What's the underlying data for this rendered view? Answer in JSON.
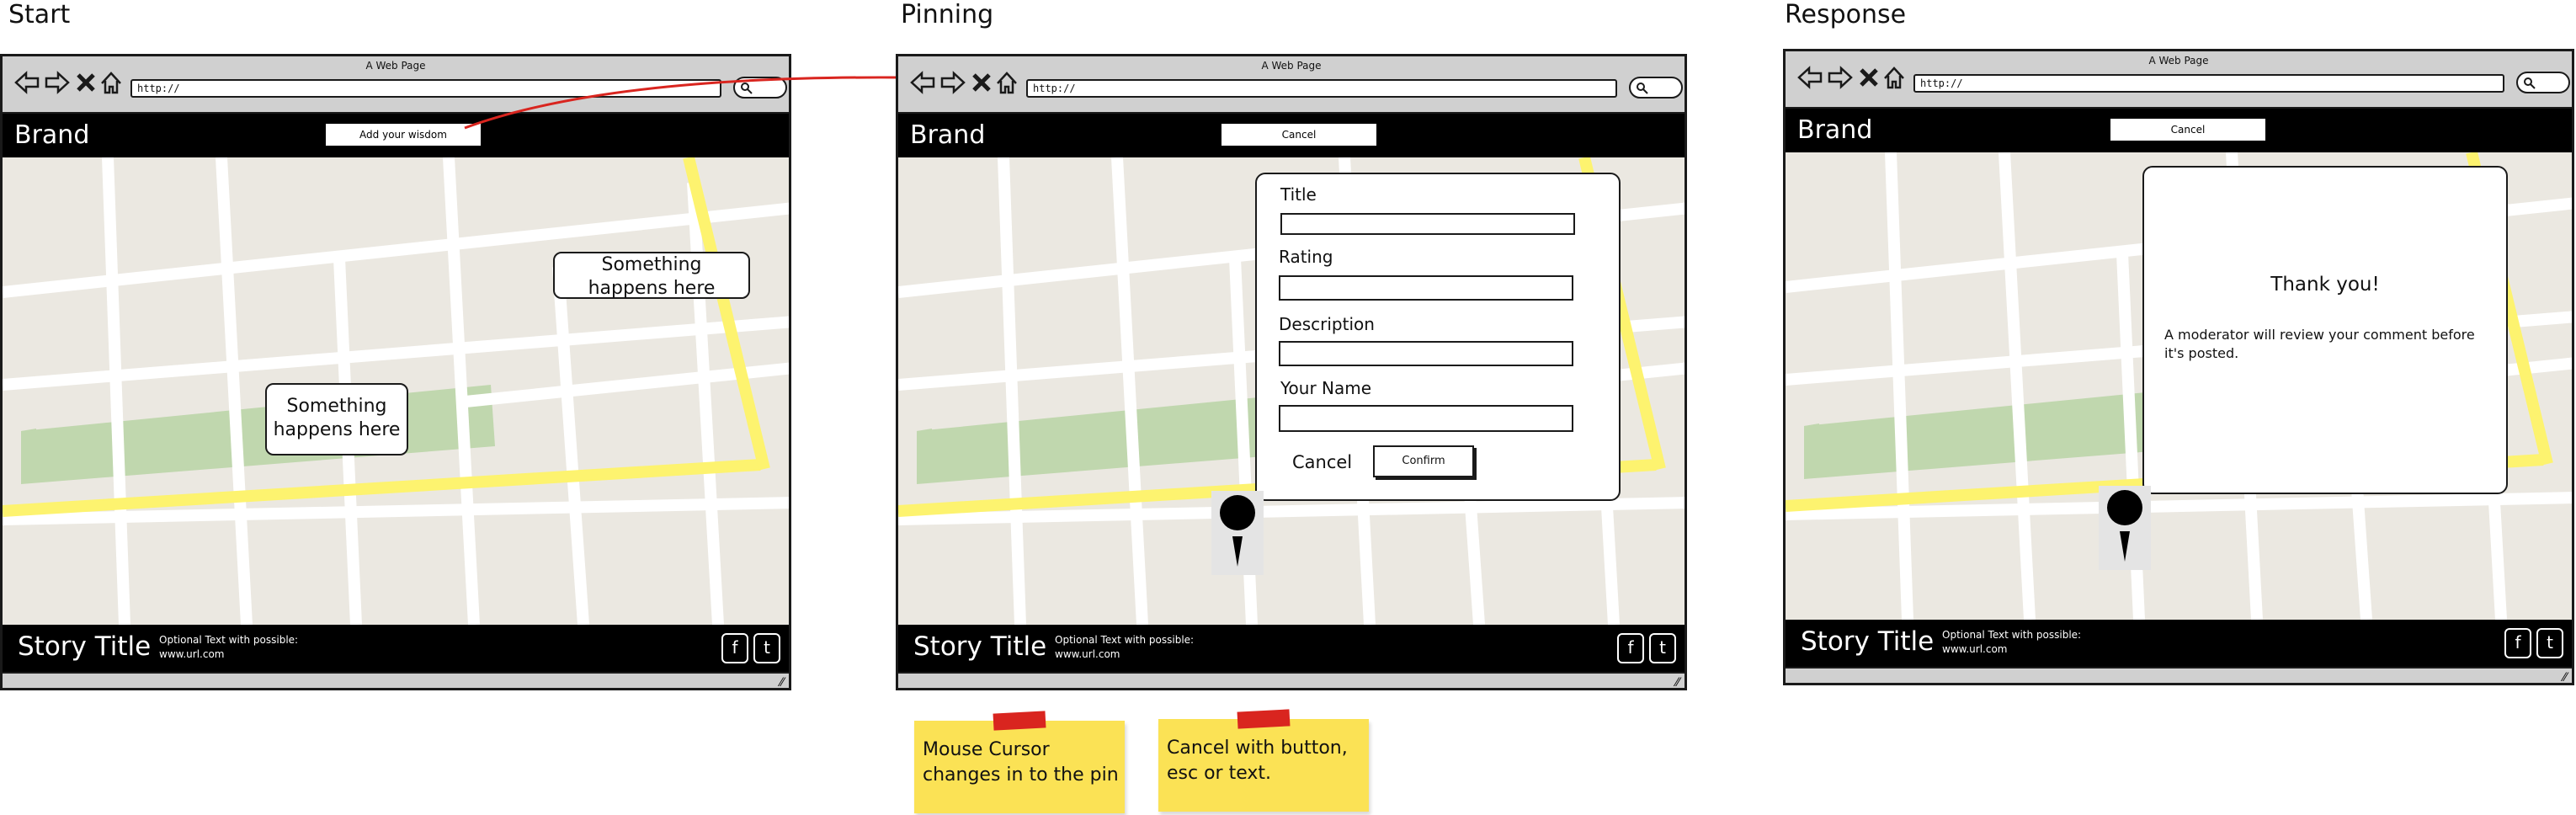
{
  "frames": [
    {
      "title": "Start",
      "browser": {
        "page_title": "A Web Page",
        "url": "http://",
        "brand": "Brand",
        "nav_button": "Add your wisdom"
      },
      "callouts": [
        {
          "text_line1": "Something",
          "text_line2": "happens here"
        },
        {
          "text_line1": "Something",
          "text_line2": "happens here"
        }
      ],
      "footer": {
        "story_title": "Story Title",
        "story_text": "Optional Text with possible:\nwww.url.com"
      }
    },
    {
      "title": "Pinning",
      "browser": {
        "page_title": "A Web Page",
        "url": "http://",
        "brand": "Brand",
        "nav_button": "Cancel"
      },
      "form": {
        "fields": [
          {
            "label": "Title"
          },
          {
            "label": "Rating"
          },
          {
            "label": "Description"
          },
          {
            "label": "Your Name"
          }
        ],
        "cancel_label": "Cancel",
        "confirm_label": "Confirm"
      },
      "footer": {
        "story_title": "Story Title",
        "story_text": "Optional Text with possible:\nwww.url.com"
      },
      "notes": [
        {
          "line1": "Mouse Cursor",
          "line2": "changes in to the pin"
        },
        {
          "line1": "Cancel with button,",
          "line2": "esc or text."
        }
      ]
    },
    {
      "title": "Response",
      "browser": {
        "page_title": "A Web Page",
        "url": "http://",
        "brand": "Brand",
        "nav_button": "Cancel"
      },
      "thank_you": {
        "title": "Thank you!",
        "body_line1": "A moderator will review your comment before",
        "body_line2": "it's posted."
      },
      "footer": {
        "story_title": "Story Title",
        "story_text": "Optional Text with possible:\nwww.url.com"
      }
    }
  ],
  "social_icons": [
    "facebook-icon",
    "twitter-icon"
  ],
  "colors": {
    "map_background": "#ebe8e1",
    "road": "#ffffff",
    "highway": "#fdf36f",
    "park": "#c0d7ae",
    "chrome": "#d0d0d0",
    "arrow": "#d9251f",
    "sticky_note": "#fbe255"
  }
}
